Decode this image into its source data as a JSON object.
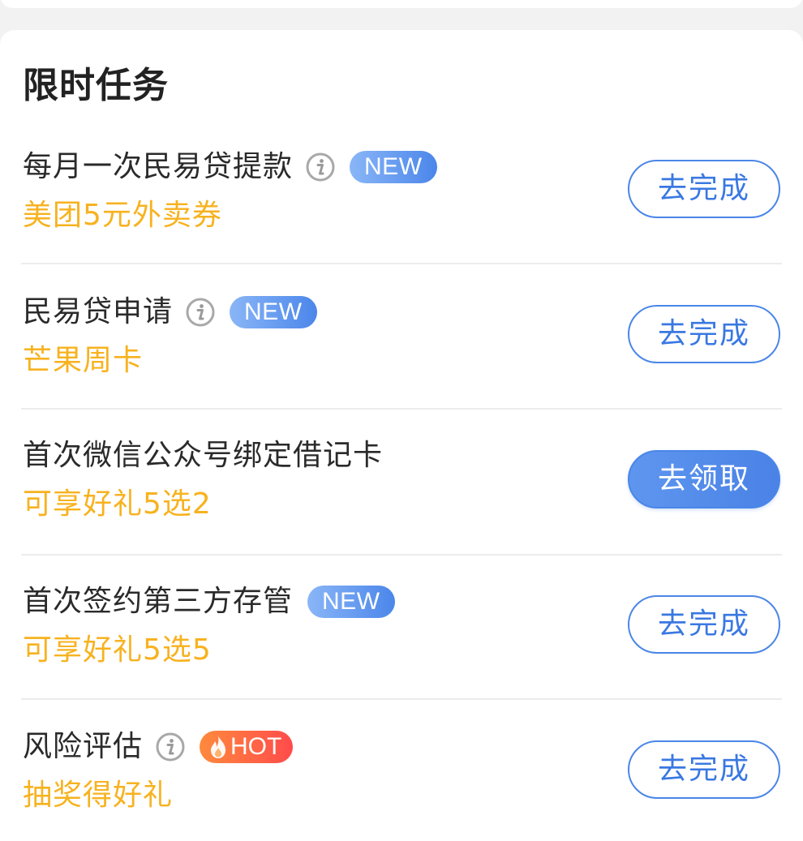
{
  "section_title": "限时任务",
  "tasks": [
    {
      "title": "每月一次民易贷提款",
      "has_info": true,
      "badge": "NEW",
      "badge_type": "new",
      "reward": "美团5元外卖券",
      "button": "去完成",
      "button_style": "outline"
    },
    {
      "title": "民易贷申请",
      "has_info": true,
      "badge": "NEW",
      "badge_type": "new",
      "reward": "芒果周卡",
      "button": "去完成",
      "button_style": "outline"
    },
    {
      "title": "首次微信公众号绑定借记卡",
      "has_info": false,
      "badge": "",
      "badge_type": "none",
      "reward": "可享好礼5选2",
      "button": "去领取",
      "button_style": "filled"
    },
    {
      "title": "首次签约第三方存管",
      "has_info": false,
      "badge": "NEW",
      "badge_type": "new",
      "reward": "可享好礼5选5",
      "button": "去完成",
      "button_style": "outline"
    },
    {
      "title": "风险评估",
      "has_info": true,
      "badge": "HOT",
      "badge_type": "hot",
      "reward": "抽奖得好礼",
      "button": "去完成",
      "button_style": "outline"
    }
  ],
  "icons": {
    "info": "info-icon",
    "hot": "flame-icon"
  },
  "colors": {
    "accent_blue": "#4a86e8",
    "reward_orange": "#f7b21f",
    "hot_red": "#ff4b4b"
  }
}
